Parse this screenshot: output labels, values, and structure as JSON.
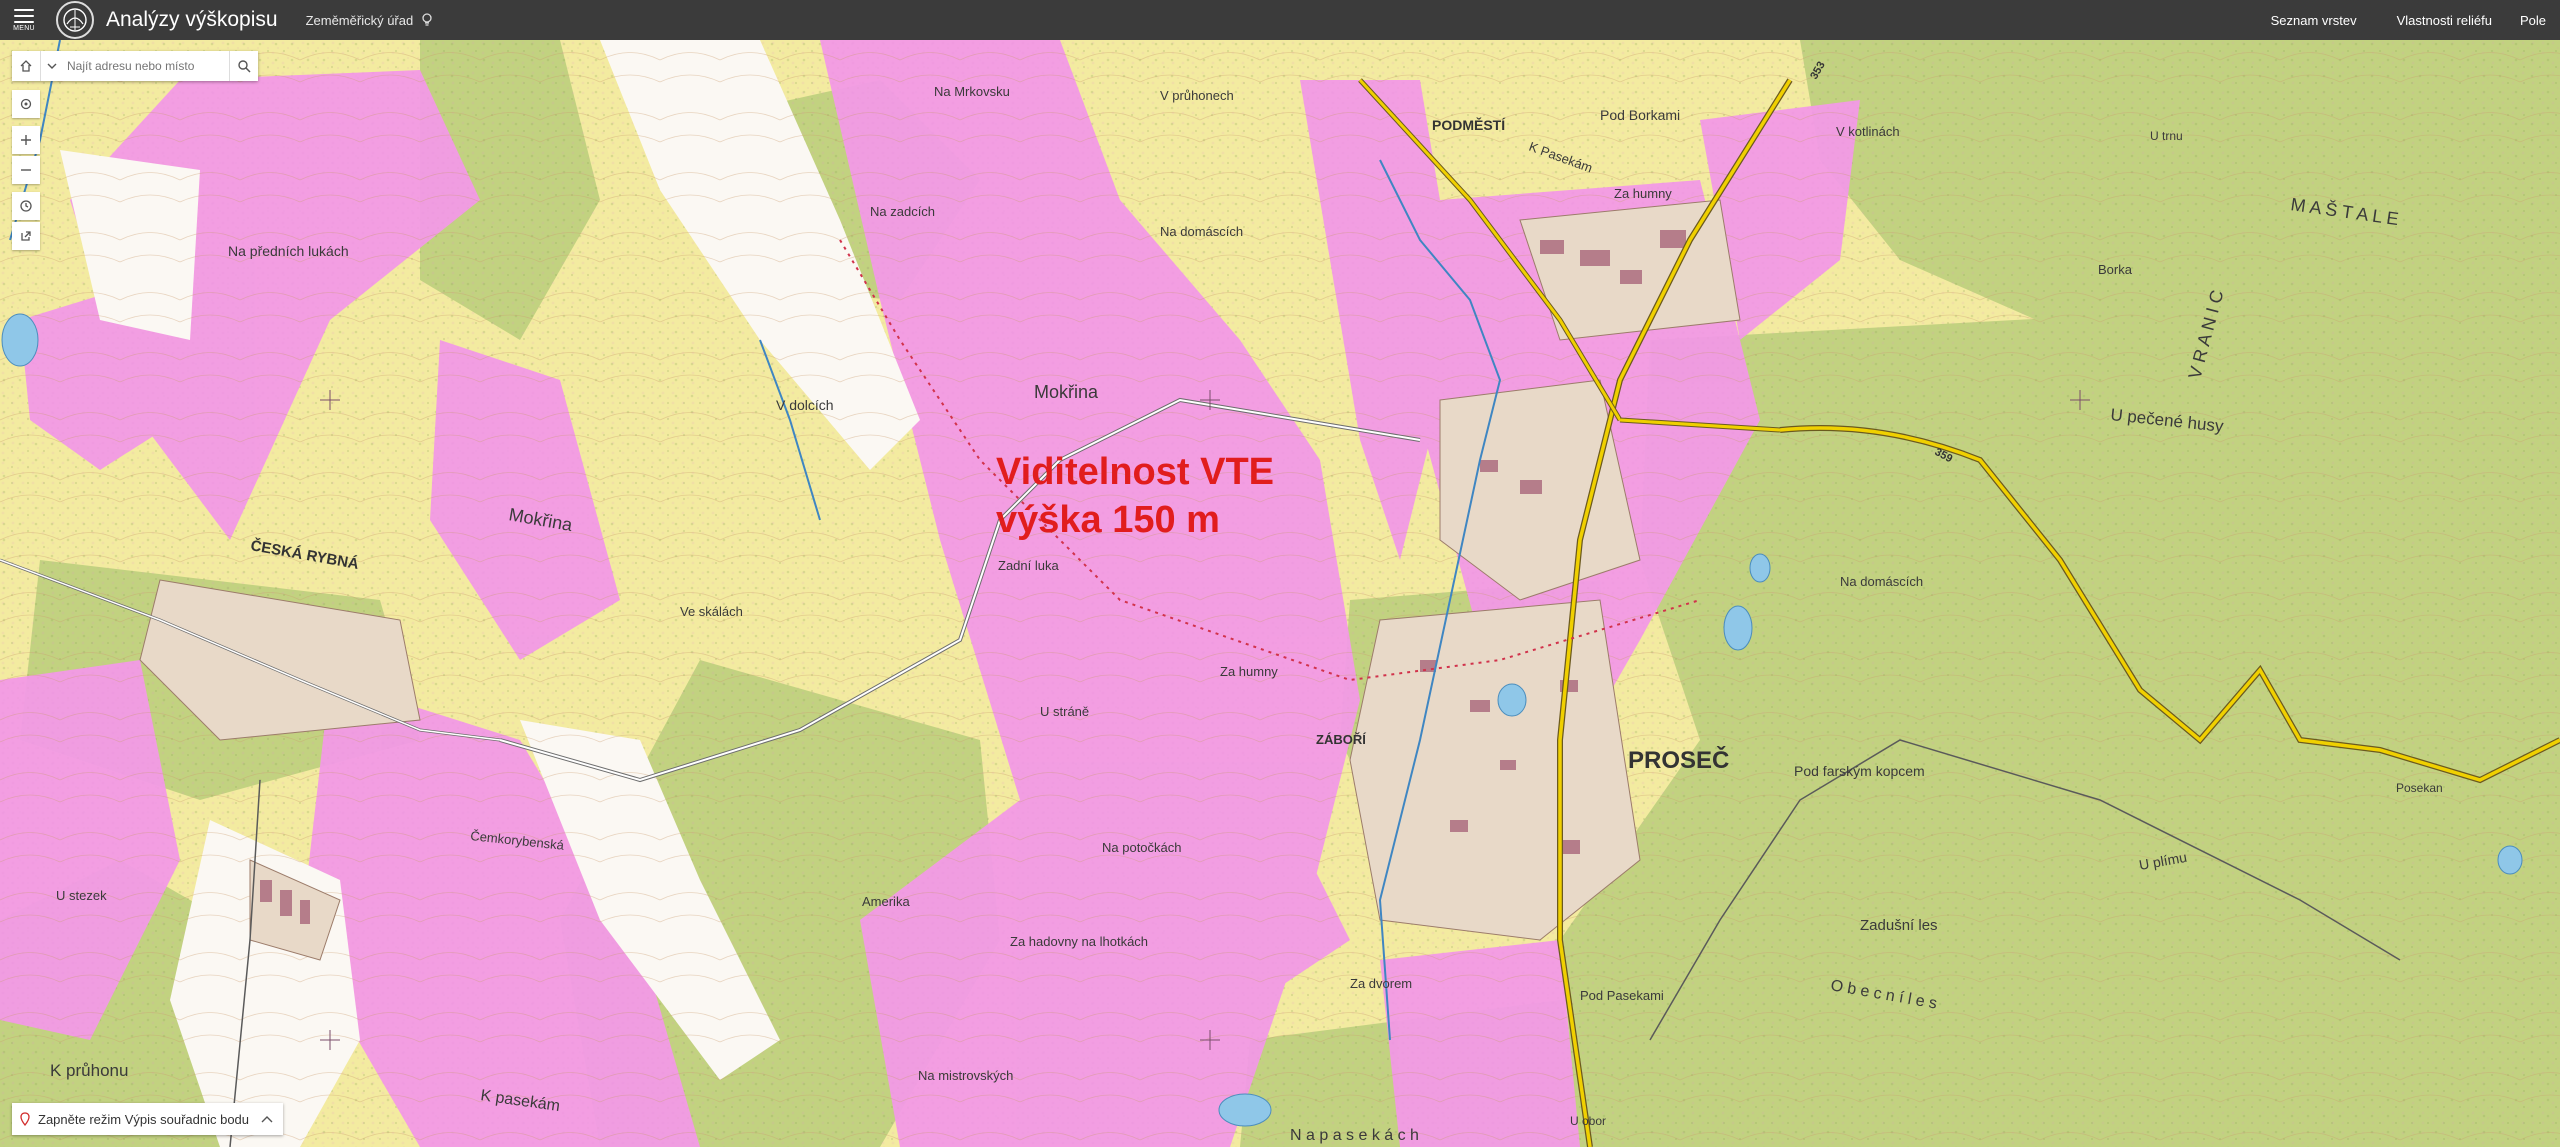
{
  "header": {
    "menu_label": "MENU",
    "app_title": "Analýzy výškopisu",
    "org_label": "Zeměměřický úřad",
    "links": [
      "Seznam vrstev",
      "Vlastnosti reliéfu",
      "Pole"
    ]
  },
  "search": {
    "placeholder": "Najít adresu nebo místo"
  },
  "overlay": {
    "line1": "Viditelnost VTE",
    "line2": "výška 150 m"
  },
  "coordinate_bar": {
    "text": "Zapněte režim Výpis souřadnic bodu"
  },
  "map_labels": {
    "podmesti": "PODMĚSTÍ",
    "pod_borkami": "Pod Borkami",
    "k_pasekam": "K Pasekám",
    "za_humny1": "Za humny",
    "na_mrkovsku": "Na Mrkovsku",
    "v_pruhonech": "V průhonech",
    "na_zadcich": "Na zadcích",
    "na_domascich1": "Na domáscích",
    "mokrina1": "Mokřina",
    "v_dolcich": "V dolcích",
    "mokrina2": "Mokřina",
    "na_prednich_lukach": "Na předních lukách",
    "ceska_rybna": "ČESKÁ RYBNÁ",
    "ve_skalach": "Ve skálách",
    "zadni_luka": "Zadní luka",
    "u_stezek": "U stezek",
    "cemkorybenska": "Čemkorybenská",
    "k_pruhonu": "K průhonu",
    "k_pasekam2": "K pasekám",
    "amerika": "Amerika",
    "u_strane": "U stráně",
    "za_humny2": "Za humny",
    "zabori": "ZÁBOŘÍ",
    "na_potockach": "Na potočkách",
    "za_hadovny": "Za hadovny na lhotkách",
    "na_mistrovskych": "Na mistrovských",
    "za_dvorem": "Za dvorem",
    "pod_pasekami": "Pod Pasekami",
    "prosec": "PROSEČ",
    "pod_farskym_kopcem": "Pod farským kopcem",
    "na_domascich2": "Na domáscích",
    "zadusni_les": "Zadušní les",
    "obecni_les": "O b e c n í   l e s",
    "u_pecene_husy": "U pečené husy",
    "borka": "Borka",
    "posekan": "Posekan",
    "v_kotlinach": "V kotlinách",
    "u_trnu": "U trnu",
    "mastale": "M A Š T A L E",
    "vranic": "V R A N I C",
    "u_plimu": "U plímu",
    "na_pasekach": "N a   p a s e k á c h",
    "u_obor": "U obor",
    "road_359": "359",
    "road_353": "353"
  },
  "icons": {
    "menu": "menu-hamburger-icon",
    "logo": "globe-logo-icon",
    "pin": "lightbulb-icon",
    "home": "home-icon",
    "dropdown": "chevron-down-icon",
    "search": "search-icon",
    "locate": "locate-icon",
    "zoom_in": "plus-icon",
    "zoom_out": "minus-icon",
    "history": "clock-icon",
    "share": "share-icon",
    "coordinate": "pin-icon",
    "collapse": "chevron-up-icon"
  },
  "colors": {
    "topbar": "#3b3b3b",
    "overlay_text": "#e11d1d",
    "visibility_pink": "#f29ae6",
    "field_yellow": "#f3eba0",
    "forest_green": "#c2d280"
  }
}
